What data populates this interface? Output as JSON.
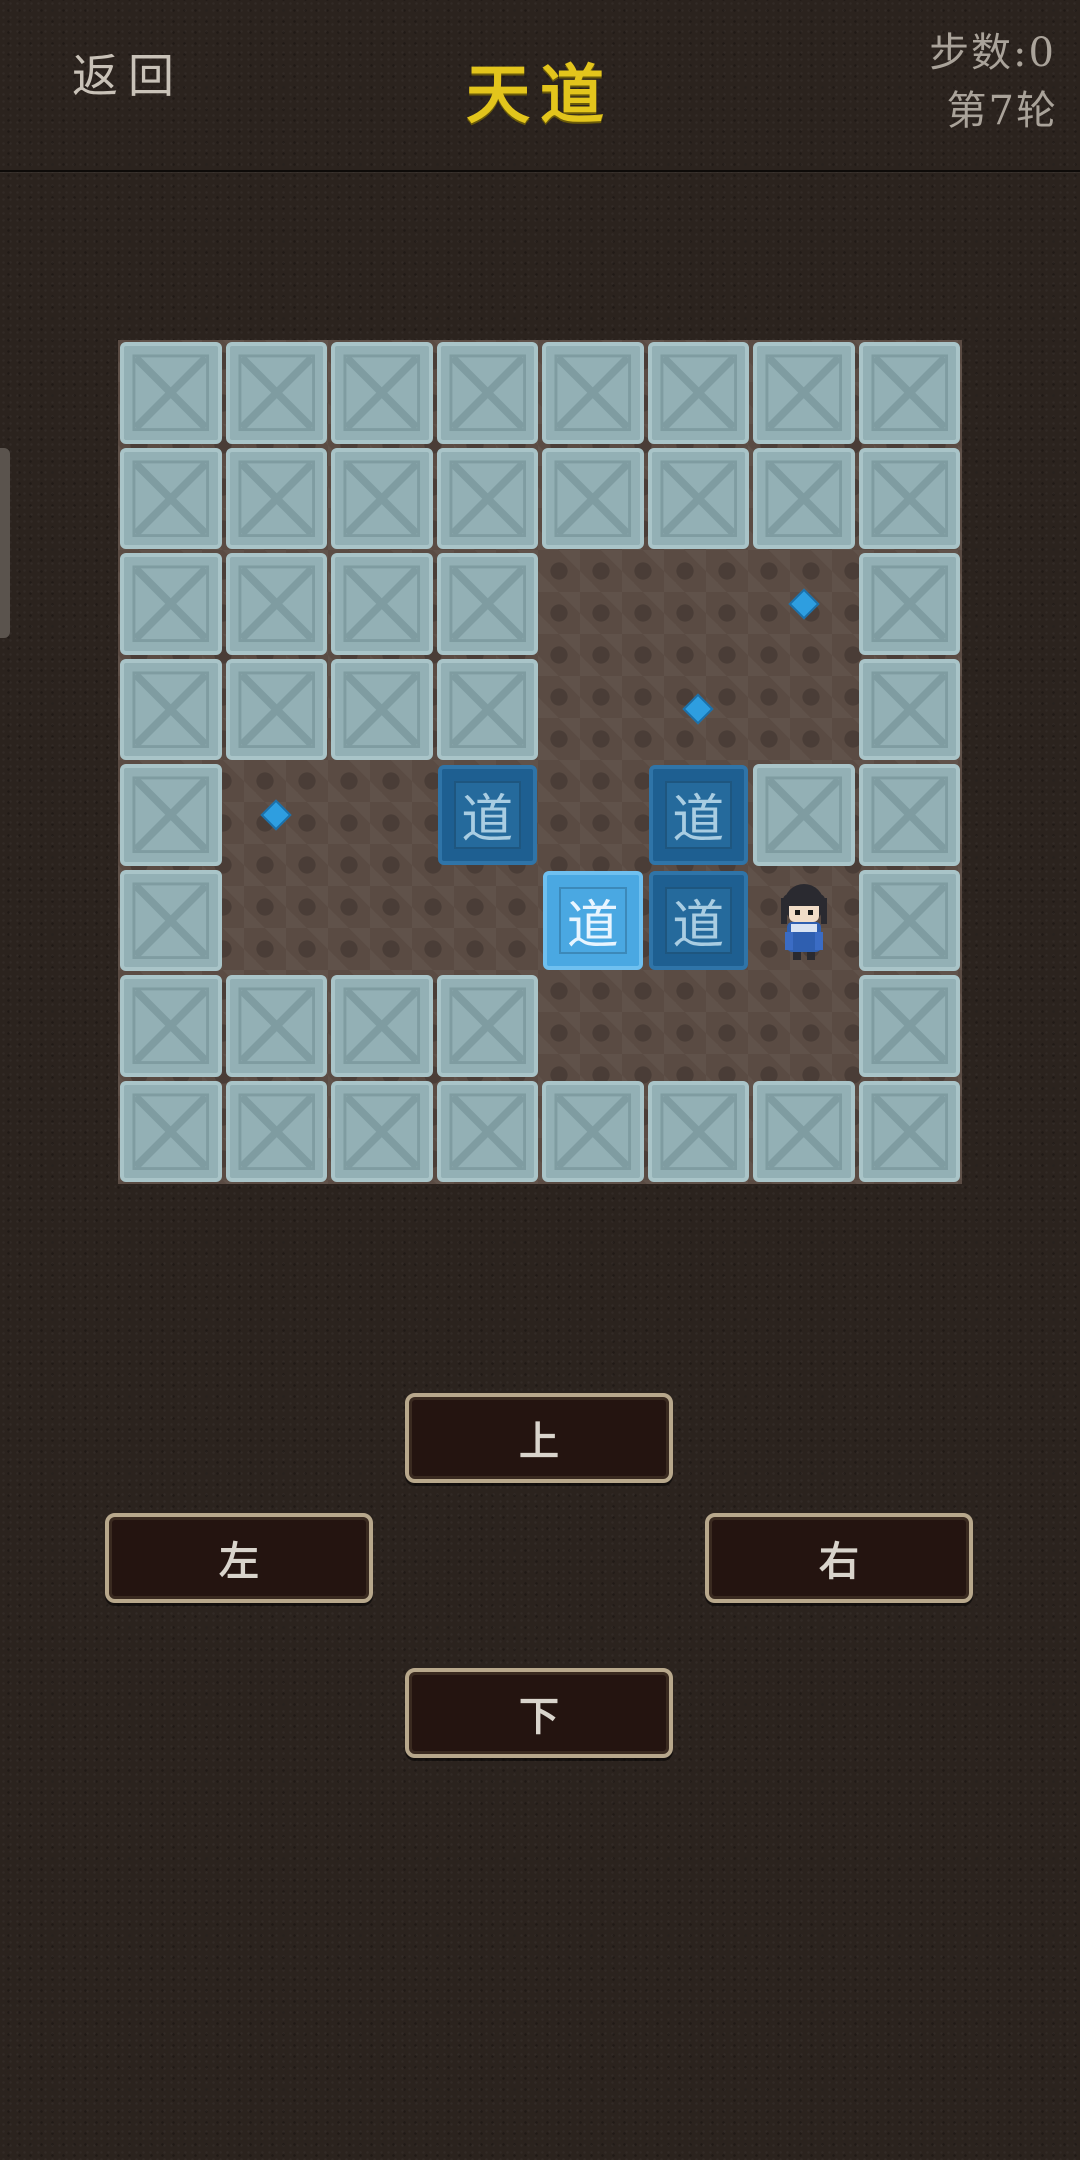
{
  "header": {
    "back_label": "返回",
    "title": "天道",
    "steps_label": "步数:0",
    "round_label": "第7轮"
  },
  "board": {
    "rows": 8,
    "cols": 8,
    "legend": {
      "W": "wall",
      ".": "floor",
      "T": "target",
      "D": "box",
      "B": "box-on-target",
      "P": "player"
    },
    "grid": [
      "WWWWWWWW",
      "WWWWWWWW",
      "WWWW..TW",
      "WWWW.T.W",
      "WT.D.DWW",
      "W...BDPW",
      "WWWW...W",
      "WWWWWWWW"
    ],
    "box_char": "道",
    "colors": {
      "wall": "#93b0b5",
      "box": "#1e5f91",
      "box_on_target": "#4aa8e2",
      "target": "#2e9ee0",
      "title": "#e3c51c"
    }
  },
  "controls": {
    "up": "上",
    "left": "左",
    "right": "右",
    "down": "下"
  }
}
